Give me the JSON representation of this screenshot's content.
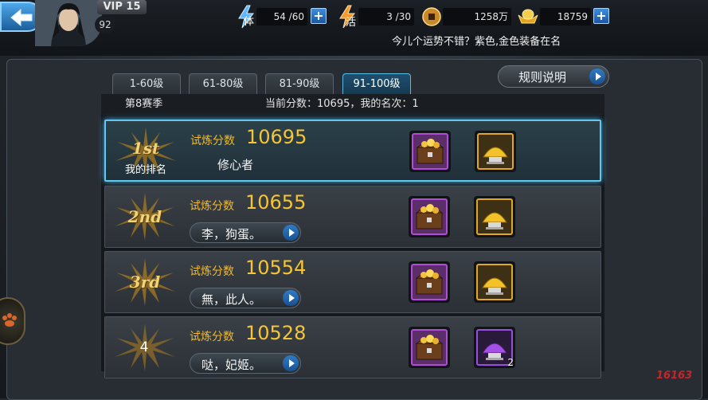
{
  "header": {
    "vip": "VIP 15",
    "level": "92",
    "stamina": {
      "label": "体",
      "value": "54 /60"
    },
    "vigor": {
      "label": "活",
      "value": "3 /30"
    },
    "coins": "1258万",
    "gold": "18759",
    "plus_label": "+",
    "ticker": "今儿个运势不错？紫色,金色装备在名"
  },
  "tabs": [
    {
      "label": "1-60级",
      "active": false
    },
    {
      "label": "61-80级",
      "active": false
    },
    {
      "label": "81-90级",
      "active": false
    },
    {
      "label": "91-100级",
      "active": true
    }
  ],
  "rules_button": "规则说明",
  "season": {
    "label": "第8赛季",
    "summary": "当前分数：10695，我的名次：1"
  },
  "rows": [
    {
      "rank": "1st",
      "rank_sub": "我的排名",
      "score_label": "试炼分数",
      "score": "10695",
      "name": "修心者",
      "reward_2_count": ""
    },
    {
      "rank": "2nd",
      "score_label": "试炼分数",
      "score": "10655",
      "name": "李，狗蛋。",
      "reward_2_count": ""
    },
    {
      "rank": "3rd",
      "score_label": "试炼分数",
      "score": "10554",
      "name": "無，此人。",
      "reward_2_count": ""
    },
    {
      "rank": "4",
      "score_label": "试炼分数",
      "score": "10528",
      "name": "哒，妃姬。",
      "reward_2_count": "2"
    }
  ],
  "icons": {
    "back": "back-arrow-icon",
    "stamina": "lightning-icon",
    "coin": "coin-icon",
    "gold": "gold-ingot-icon",
    "reward_chest": "treasure-chest-icon",
    "reward_gold_pile": "gold-pile-icon",
    "reward_purple_pile": "purple-pile-icon"
  },
  "watermark": "16163",
  "colors": {
    "score": "#f5c534",
    "accent": "#63c6ee",
    "panel": "#282d33"
  }
}
